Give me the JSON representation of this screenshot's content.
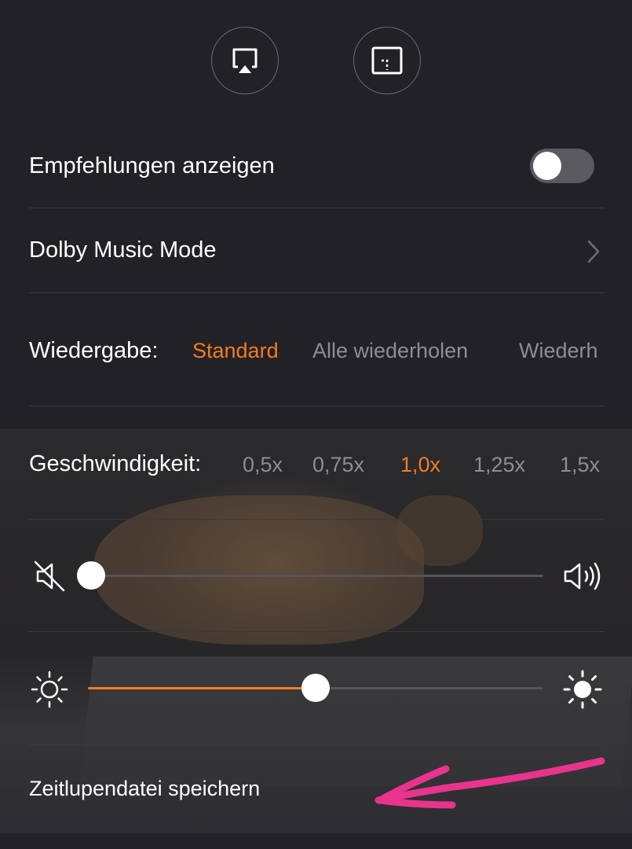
{
  "colors": {
    "background": "#222126",
    "accent": "#f07c22",
    "text": "#ffffff",
    "muted_text": "#8e8d92",
    "annotation_arrow": "#e8348c"
  },
  "top_buttons": [
    {
      "icon": "airplay-icon"
    },
    {
      "icon": "picture-in-picture-icon"
    }
  ],
  "recommendations": {
    "label": "Empfehlungen anzeigen",
    "toggle_on": false
  },
  "dolby": {
    "label": "Dolby Music Mode",
    "icon": "chevron-right-icon"
  },
  "playback": {
    "label": "Wiedergabe:",
    "options": [
      "Standard",
      "Alle wiederholen",
      "Wiederh"
    ],
    "selected": "Standard"
  },
  "speed": {
    "label": "Geschwindigkeit:",
    "options": [
      "0,5x",
      "0,75x",
      "1,0x",
      "1,25x",
      "1,5x"
    ],
    "selected": "1,0x"
  },
  "volume": {
    "level": 0,
    "min_icon": "volume-mute-icon",
    "max_icon": "volume-high-icon"
  },
  "brightness": {
    "level": 0.5,
    "min_icon": "brightness-low-icon",
    "max_icon": "brightness-high-icon"
  },
  "save_slowmo": {
    "label": "Zeitlupendatei speichern"
  }
}
